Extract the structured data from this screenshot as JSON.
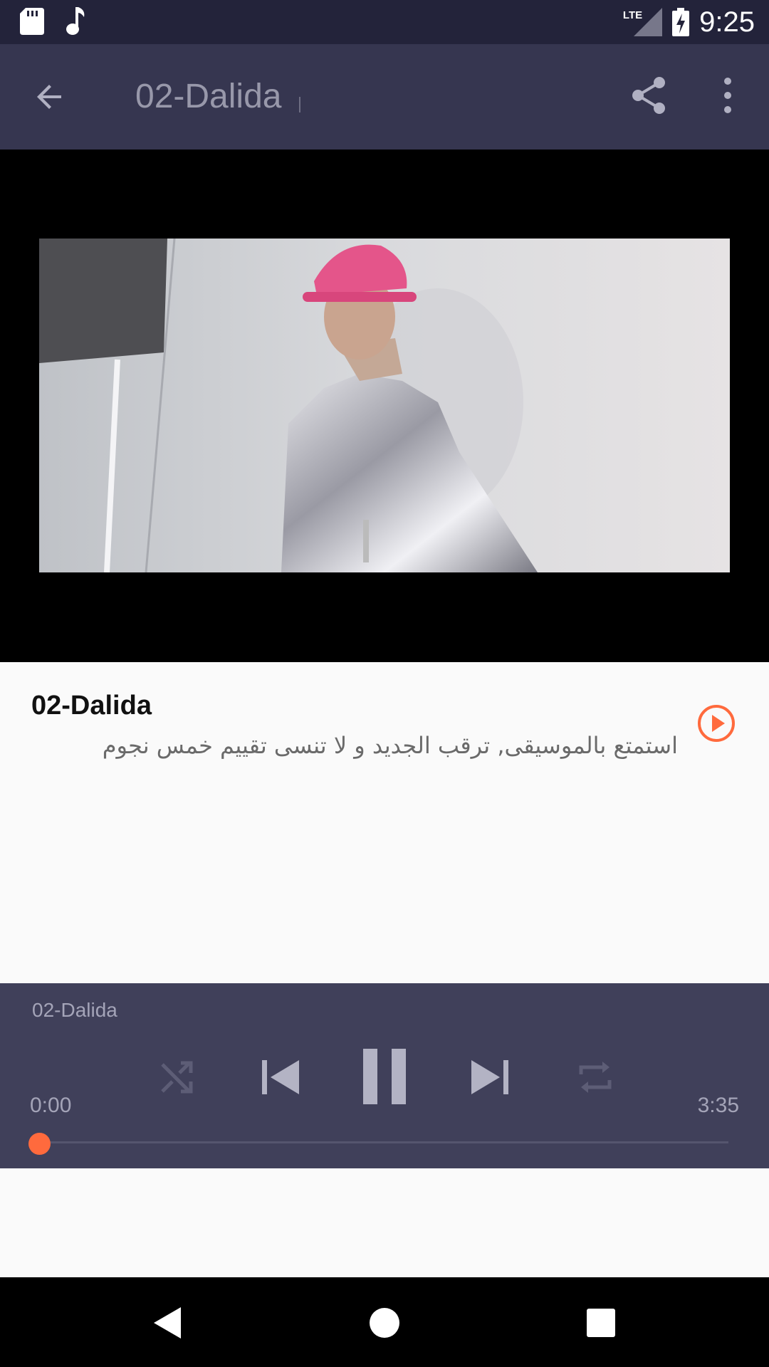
{
  "status_bar": {
    "time": "9:25",
    "network": "LTE",
    "icons": [
      "sd-card-icon",
      "music-note-icon",
      "signal-icon",
      "battery-charging-icon"
    ]
  },
  "app_bar": {
    "title": "02-Dalida",
    "icons": [
      "back-arrow-icon",
      "share-icon",
      "more-vert-icon"
    ]
  },
  "track": {
    "title": "02-Dalida",
    "description": "استمتع بالموسيقى, ترقب الجديد و لا تنسى تقييم خمس نجوم",
    "accent_color": "#ff6a3d"
  },
  "player": {
    "title": "02-Dalida",
    "current_time": "0:00",
    "duration": "3:35",
    "progress_fraction": 0.0,
    "controls": [
      "shuffle-icon",
      "skip-previous-icon",
      "pause-icon",
      "skip-next-icon",
      "repeat-icon"
    ]
  },
  "nav_bar": {
    "icons": [
      "nav-back-icon",
      "nav-home-icon",
      "nav-recents-icon"
    ]
  },
  "colors": {
    "status_bar": "#23233a",
    "app_bar": "#363650",
    "player_bg": "#40405a",
    "accent": "#ff6a3d"
  }
}
